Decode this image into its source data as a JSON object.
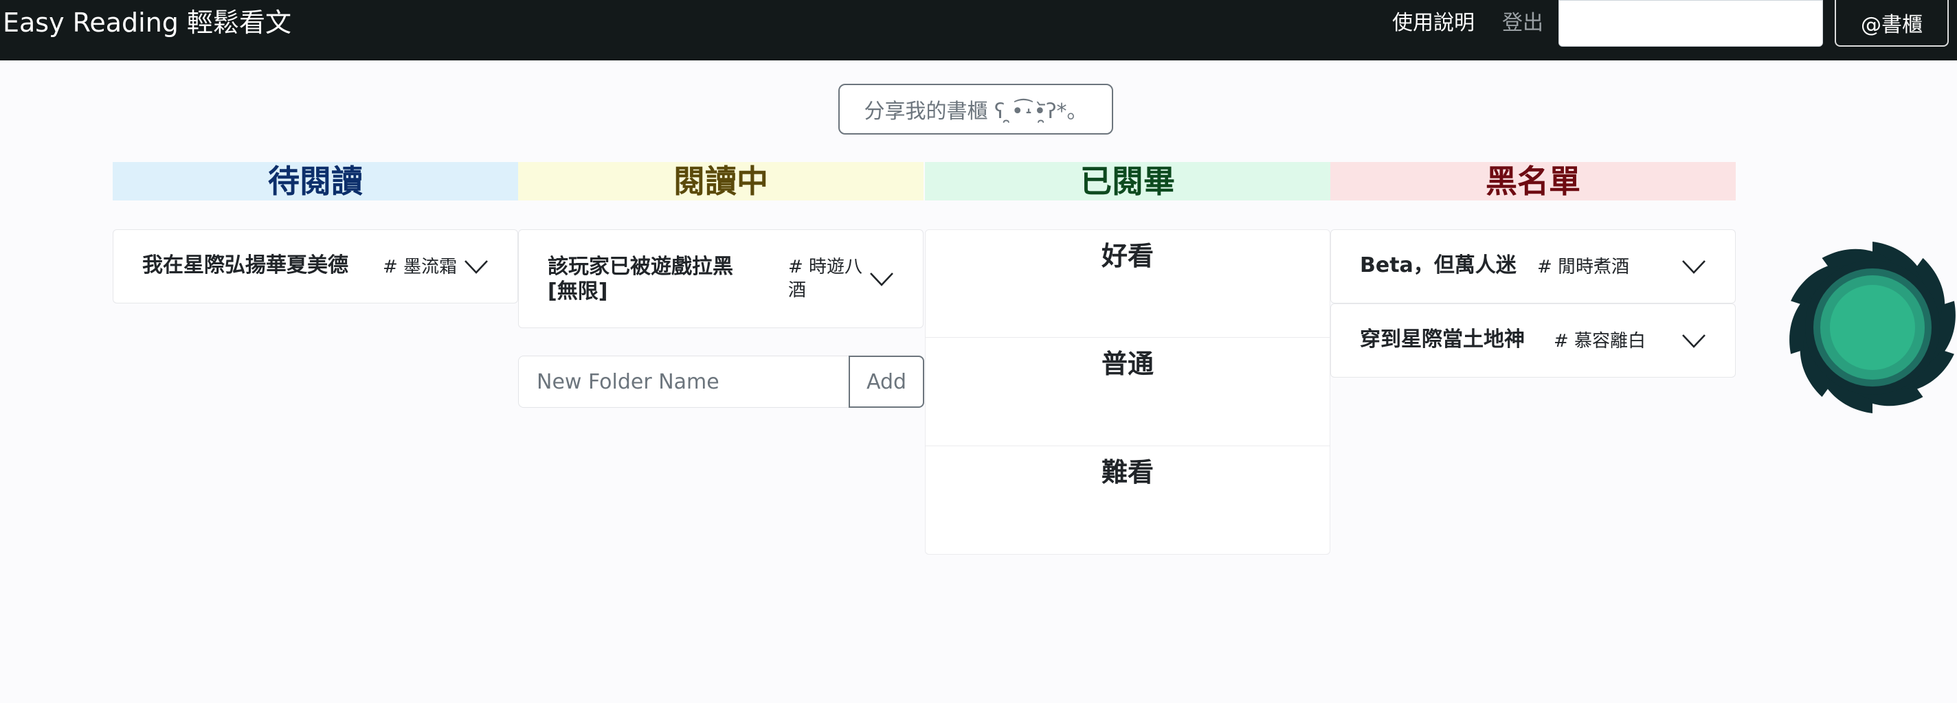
{
  "navbar": {
    "brand": "Easy Reading 輕鬆看文",
    "help_label": "使用說明",
    "logout_label": "登出",
    "search_placeholder": "",
    "shelf_button_label": "@書櫃"
  },
  "share_button_label": "分享我的書櫃 ʕ ̯•͡˔•̯᷅ʔ*。",
  "columns": {
    "to_read": {
      "title": "待閱讀",
      "books": [
        {
          "title": "我在星際弘揚華夏美德",
          "tag": "# 墨流霜"
        }
      ]
    },
    "reading": {
      "title": "閱讀中",
      "books": [
        {
          "title_line1": "該玩家已被遊戲拉黑",
          "title_line2": "[無限]",
          "tag_line1": "# 時遊八",
          "tag_line2": "酒"
        }
      ],
      "new_folder_placeholder": "New Folder Name",
      "add_label": "Add"
    },
    "done": {
      "title": "已閱畢",
      "folders": [
        "好看",
        "普通",
        "難看"
      ]
    },
    "blacklist": {
      "title": "黑名單",
      "books": [
        {
          "title": "Beta，但萬人迷",
          "tag": "# 閒時煮酒"
        },
        {
          "title": "穿到星際當土地神",
          "tag": "# 慕容離白"
        }
      ]
    }
  },
  "colors": {
    "navbar_bg": "#13191a",
    "to_read_bg": "#ddf0fb",
    "reading_bg": "#fbfbdc",
    "done_bg": "#def9ea",
    "blacklist_bg": "#fbe3e4",
    "spinner_teal": "#2fb58a",
    "spinner_dark": "#0f2e33"
  },
  "icons": [
    "chevron-down-icon",
    "loading-spinner-icon"
  ]
}
